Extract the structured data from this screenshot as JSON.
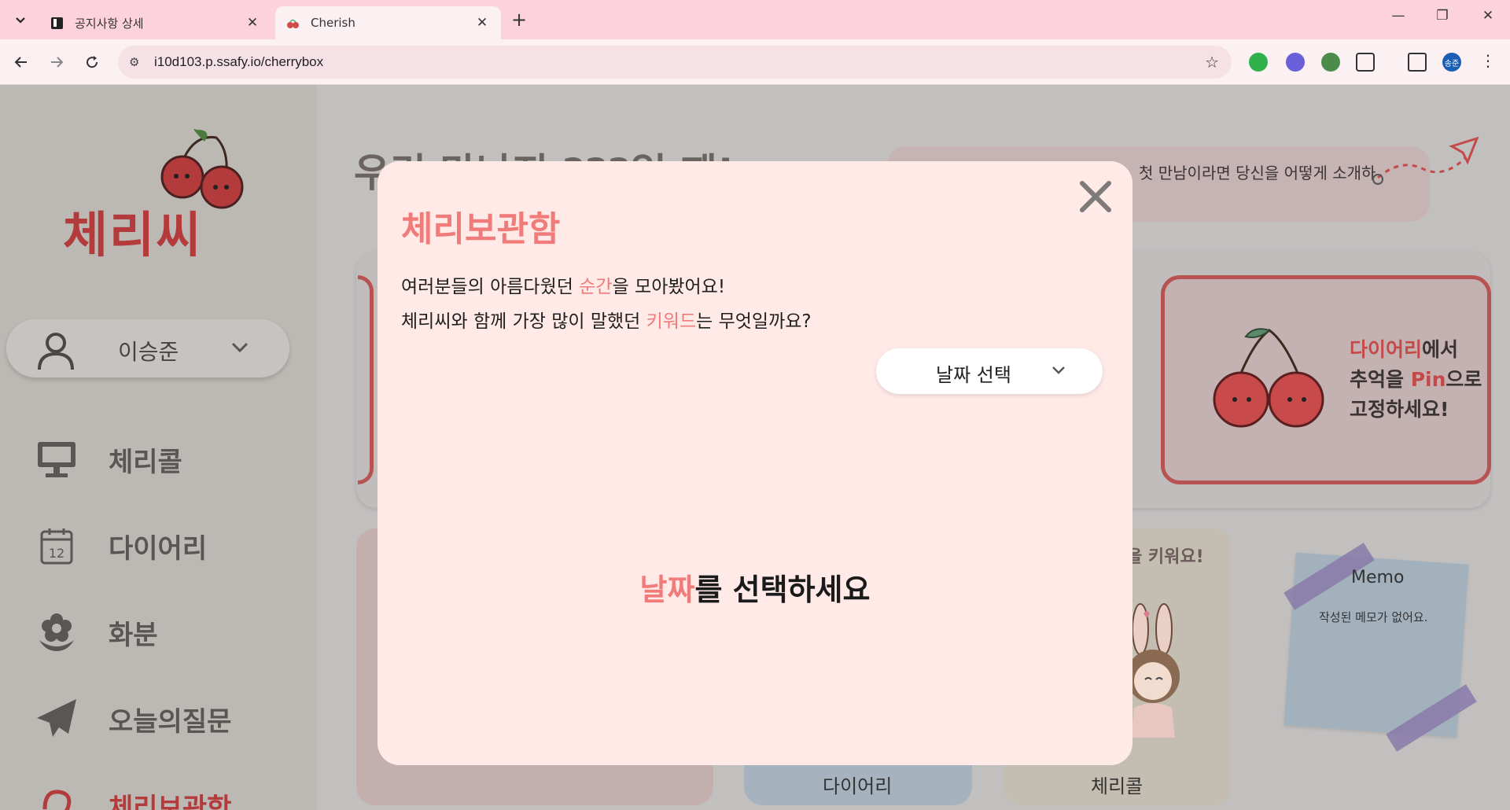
{
  "browser": {
    "tabs": [
      {
        "title": "공지사항 상세",
        "active": false
      },
      {
        "title": "Cherish",
        "active": true
      }
    ],
    "url": "i10d103.p.ssafy.io/cherrybox",
    "profile_initials": "송준"
  },
  "sidebar": {
    "logo": "체리씨",
    "user_name": "이승준",
    "items": [
      {
        "label": "체리콜",
        "icon": "monitor-icon"
      },
      {
        "label": "다이어리",
        "icon": "calendar-icon"
      },
      {
        "label": "화분",
        "icon": "flower-icon"
      },
      {
        "label": "오늘의질문",
        "icon": "paper-plane-icon"
      },
      {
        "label": "체리보관함",
        "icon": "rose-icon"
      }
    ]
  },
  "main": {
    "headline": "우리 만난지 ???일 째!",
    "question_text": "첫 만남이라면 당신을 어떻게 소개하",
    "promo": {
      "line1_hl": "다이어리",
      "line1_rest": "에서",
      "line2_pre": "추억을 ",
      "line2_hl": "Pin",
      "line2_rest": "으로",
      "line3": "고정하세요!"
    },
    "card_labels": {
      "diary": "다이어리",
      "cherrycall": "체리콜"
    },
    "keyword_hint": "을 키워요!",
    "memo": {
      "title": "Memo",
      "body": "작성된 메모가 없어요."
    }
  },
  "modal": {
    "title": "체리보관함",
    "line1": {
      "pre": "여러분들의 아름다웠던 ",
      "hl": "순간",
      "post": "을 모아봤어요!"
    },
    "line2": {
      "pre": "체리씨와 함께 가장 많이 말했던 ",
      "hl": "키워드",
      "post": "는 무엇일까요?"
    },
    "date_select_label": "날짜 선택",
    "empty_message": {
      "hl": "날짜",
      "rest": "를 선택하세요"
    }
  },
  "colors": {
    "accent": "#f07b79",
    "brand_red": "#b43b3b",
    "modal_bg": "#ffeae8",
    "tabbar": "#fcd3dc"
  }
}
